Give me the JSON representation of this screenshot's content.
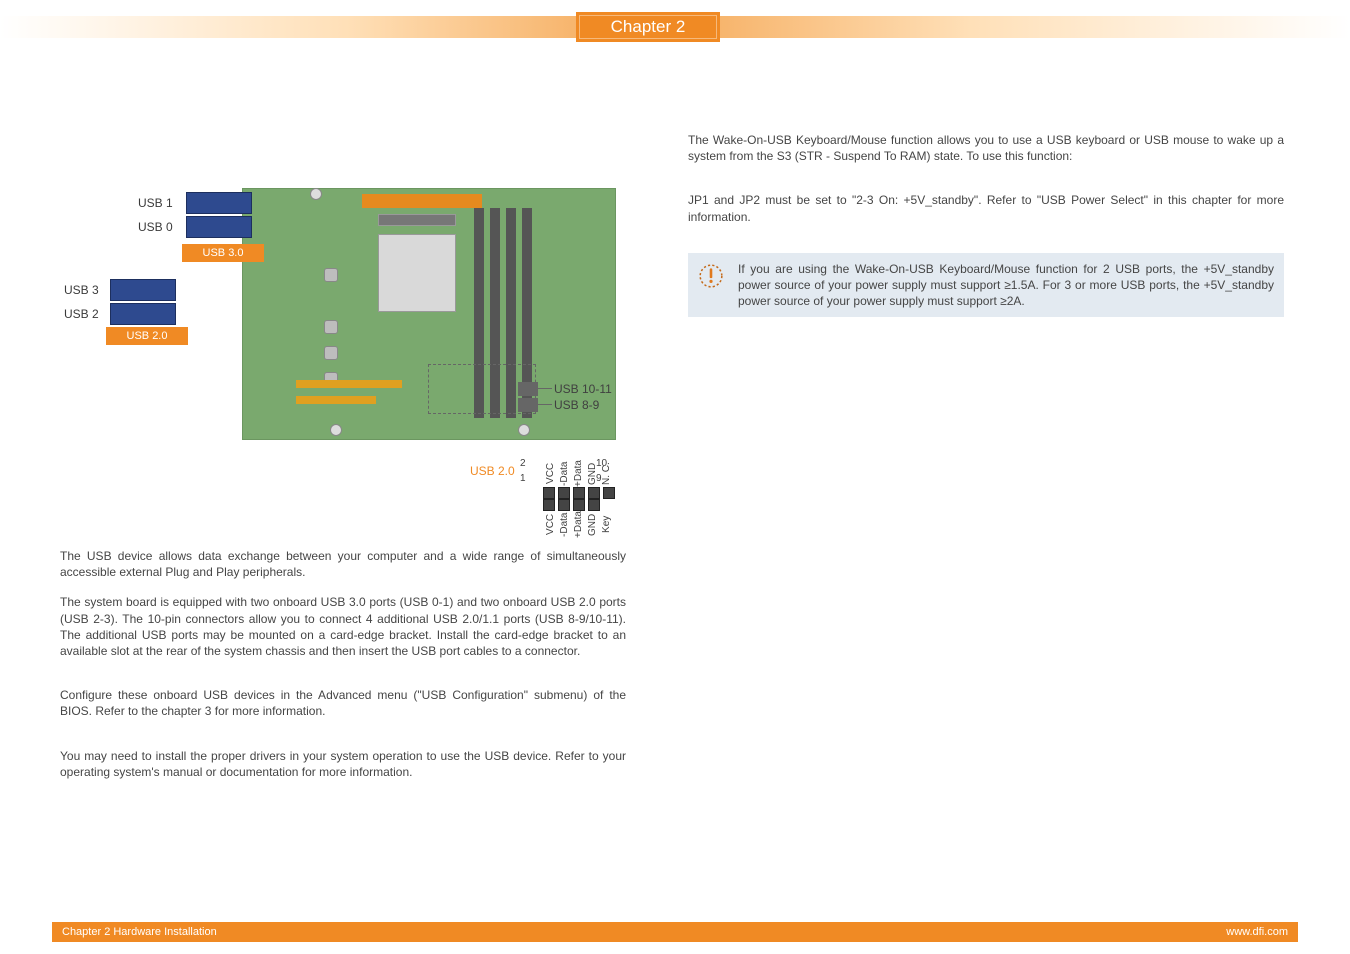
{
  "chapter_box": "Chapter 2",
  "board": {
    "usb1": "USB 1",
    "usb0": "USB 0",
    "usb3": "USB 3",
    "usb2": "USB 2",
    "usb30_tag": "USB 3.0",
    "usb20_tag": "USB 2.0",
    "hdr1011": "USB 10-11",
    "hdr89": "USB 8-9",
    "usb20_pinlabel": "USB 2.0",
    "pin_top": [
      "VCC",
      "-Data",
      "+Data",
      "GND",
      "N. C."
    ],
    "pin_bot": [
      "VCC",
      "-Data",
      "+Data",
      "GND",
      "Key"
    ],
    "num1": "1",
    "num2": "2",
    "num9": "9",
    "num10": "10"
  },
  "left": {
    "p1": "The USB device allows data exchange between your computer and a wide range of simultaneously accessible external Plug and Play peripherals.",
    "p2": "The system board is equipped with two onboard USB 3.0 ports (USB 0-1) and two onboard USB 2.0 ports (USB 2-3). The 10-pin connectors allow you to connect 4 additional USB 2.0/1.1 ports (USB 8-9/10-11). The additional USB ports may be mounted on a card-edge bracket. Install the card-edge bracket to an available slot at the rear of the system chassis and then insert the USB port cables to a connector.",
    "p3": "Configure these onboard USB devices in the Advanced menu (\"USB Configuration\" submenu) of the BIOS. Refer to the chapter 3 for more information.",
    "p4": "You may need to install the proper drivers in your system operation to use the USB device. Refer to your operating system's manual or documentation for more information."
  },
  "right": {
    "p1": "The Wake-On-USB Keyboard/Mouse function allows you to use a USB keyboard or USB mouse to wake up a system from the S3 (STR - Suspend To RAM) state. To use this function:",
    "p2": "JP1 and JP2 must be set to \"2-3 On: +5V_standby\". Refer to \"USB Power Select\" in this chapter for more information.",
    "note": "If you are using the Wake-On-USB Keyboard/Mouse function for 2 USB ports, the +5V_standby power source of your power supply must support ≥1.5A. For 3 or more USB ports, the +5V_standby power source of your power supply must support ≥2A."
  },
  "footer": {
    "left": "Chapter 2 Hardware Installation",
    "right": "www.dfi.com"
  }
}
